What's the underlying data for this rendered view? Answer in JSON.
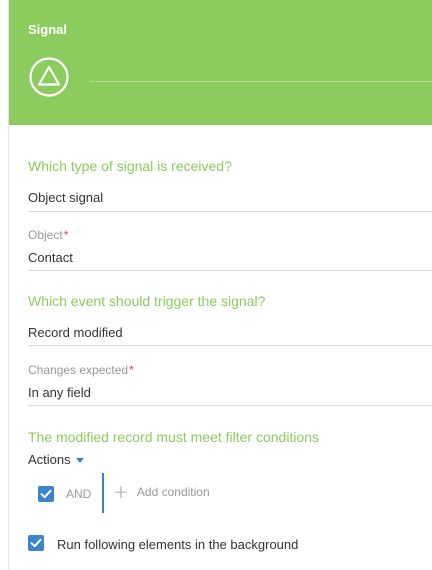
{
  "header": {
    "title": "Signal",
    "icon": "signal-triangle-icon"
  },
  "signal_type": {
    "section_title": "Which type of signal is received?",
    "value": "Object signal"
  },
  "object": {
    "label": "Object",
    "required_mark": "*",
    "value": "Contact"
  },
  "event": {
    "section_title": "Which event should trigger the signal?",
    "value": "Record modified"
  },
  "changes": {
    "label": "Changes expected",
    "required_mark": "*",
    "value": "In any field"
  },
  "filter": {
    "section_title": "The modified record must meet filter conditions",
    "actions_label": "Actions",
    "group_checked": true,
    "group_operator": "AND",
    "add_condition_label": "Add condition"
  },
  "background": {
    "checked": true,
    "label": "Run following elements in the background"
  },
  "colors": {
    "header_green": "#8ccb5e",
    "section_green": "#8ccb5e",
    "accent_blue": "#3b84c9",
    "required_red": "#e03c3c"
  }
}
